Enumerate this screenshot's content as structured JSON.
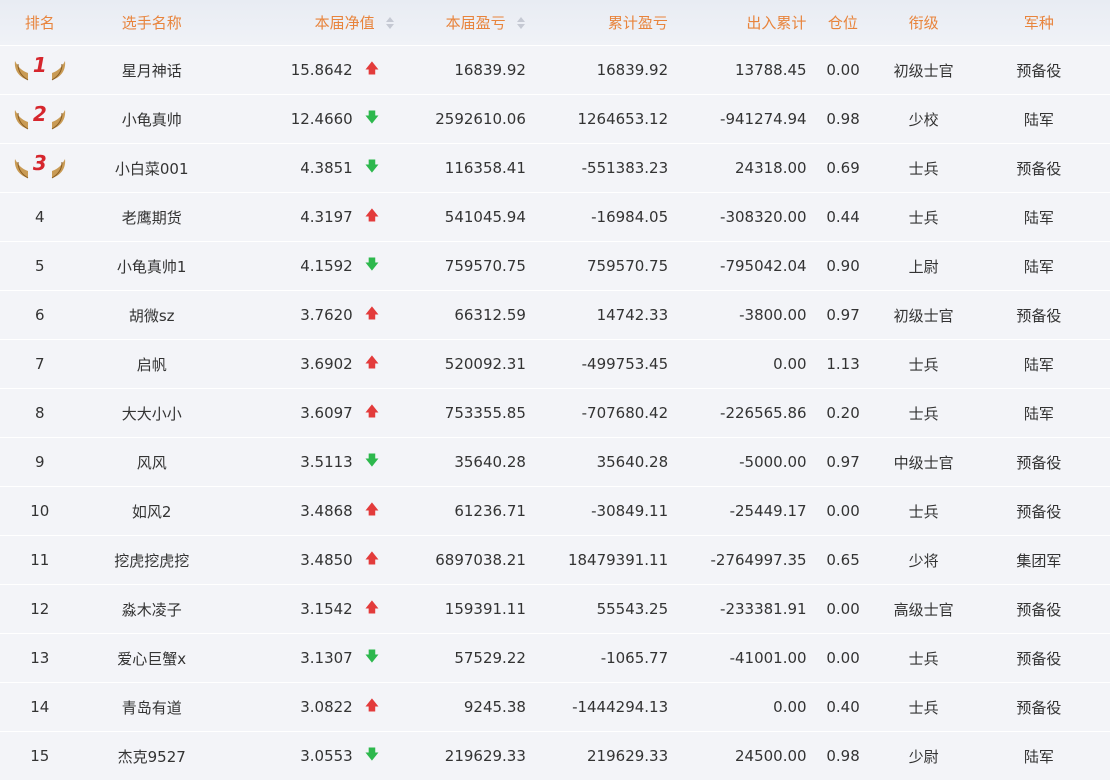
{
  "header": {
    "rank": "排名",
    "name": "选手名称",
    "nav": "本届净值",
    "pnl": "本届盈亏",
    "cum_pnl": "累计盈亏",
    "io_total": "出入累计",
    "position": "仓位",
    "rank_title": "衔级",
    "arm": "军种"
  },
  "icons": {
    "up": "arrow-up-icon",
    "down": "arrow-down-icon",
    "sort": "sort-icon",
    "medal": "laurel-wings-icon"
  },
  "colors": {
    "header_text": "#e8843c",
    "up": "#e33b3b",
    "down": "#2db84d",
    "medal_num": "#d6262d"
  },
  "rows": [
    {
      "rank": "1",
      "name": "星月神话",
      "nav": "15.8642",
      "dir": "up",
      "pnl": "16839.92",
      "cum": "16839.92",
      "io": "13788.45",
      "pos": "0.00",
      "title": "初级士官",
      "arm": "预备役"
    },
    {
      "rank": "2",
      "name": "小龟真帅",
      "nav": "12.4660",
      "dir": "down",
      "pnl": "2592610.06",
      "cum": "1264653.12",
      "io": "-941274.94",
      "pos": "0.98",
      "title": "少校",
      "arm": "陆军"
    },
    {
      "rank": "3",
      "name": "小白菜001",
      "nav": "4.3851",
      "dir": "down",
      "pnl": "116358.41",
      "cum": "-551383.23",
      "io": "24318.00",
      "pos": "0.69",
      "title": "士兵",
      "arm": "预备役"
    },
    {
      "rank": "4",
      "name": "老鹰期货",
      "nav": "4.3197",
      "dir": "up",
      "pnl": "541045.94",
      "cum": "-16984.05",
      "io": "-308320.00",
      "pos": "0.44",
      "title": "士兵",
      "arm": "陆军"
    },
    {
      "rank": "5",
      "name": "小龟真帅1",
      "nav": "4.1592",
      "dir": "down",
      "pnl": "759570.75",
      "cum": "759570.75",
      "io": "-795042.04",
      "pos": "0.90",
      "title": "上尉",
      "arm": "陆军"
    },
    {
      "rank": "6",
      "name": "胡微sz",
      "nav": "3.7620",
      "dir": "up",
      "pnl": "66312.59",
      "cum": "14742.33",
      "io": "-3800.00",
      "pos": "0.97",
      "title": "初级士官",
      "arm": "预备役"
    },
    {
      "rank": "7",
      "name": "启帆",
      "nav": "3.6902",
      "dir": "up",
      "pnl": "520092.31",
      "cum": "-499753.45",
      "io": "0.00",
      "pos": "1.13",
      "title": "士兵",
      "arm": "陆军"
    },
    {
      "rank": "8",
      "name": "大大小小",
      "nav": "3.6097",
      "dir": "up",
      "pnl": "753355.85",
      "cum": "-707680.42",
      "io": "-226565.86",
      "pos": "0.20",
      "title": "士兵",
      "arm": "陆军"
    },
    {
      "rank": "9",
      "name": "风风",
      "nav": "3.5113",
      "dir": "down",
      "pnl": "35640.28",
      "cum": "35640.28",
      "io": "-5000.00",
      "pos": "0.97",
      "title": "中级士官",
      "arm": "预备役"
    },
    {
      "rank": "10",
      "name": "如风2",
      "nav": "3.4868",
      "dir": "up",
      "pnl": "61236.71",
      "cum": "-30849.11",
      "io": "-25449.17",
      "pos": "0.00",
      "title": "士兵",
      "arm": "预备役"
    },
    {
      "rank": "11",
      "name": "挖虎挖虎挖",
      "nav": "3.4850",
      "dir": "up",
      "pnl": "6897038.21",
      "cum": "18479391.11",
      "io": "-2764997.35",
      "pos": "0.65",
      "title": "少将",
      "arm": "集团军"
    },
    {
      "rank": "12",
      "name": "淼木凌子",
      "nav": "3.1542",
      "dir": "up",
      "pnl": "159391.11",
      "cum": "55543.25",
      "io": "-233381.91",
      "pos": "0.00",
      "title": "高级士官",
      "arm": "预备役"
    },
    {
      "rank": "13",
      "name": "爱心巨蟹x",
      "nav": "3.1307",
      "dir": "down",
      "pnl": "57529.22",
      "cum": "-1065.77",
      "io": "-41001.00",
      "pos": "0.00",
      "title": "士兵",
      "arm": "预备役"
    },
    {
      "rank": "14",
      "name": "青岛有道",
      "nav": "3.0822",
      "dir": "up",
      "pnl": "9245.38",
      "cum": "-1444294.13",
      "io": "0.00",
      "pos": "0.40",
      "title": "士兵",
      "arm": "预备役"
    },
    {
      "rank": "15",
      "name": "杰克9527",
      "nav": "3.0553",
      "dir": "down",
      "pnl": "219629.33",
      "cum": "219629.33",
      "io": "24500.00",
      "pos": "0.98",
      "title": "少尉",
      "arm": "陆军"
    }
  ]
}
